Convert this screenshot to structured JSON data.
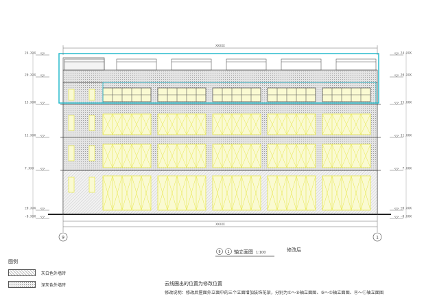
{
  "drawing": {
    "title_circle_a": "9",
    "title_circle_b": "1",
    "title": "轴立面图",
    "scale": "1:100",
    "status": "修改后",
    "total_width_dim": "XXXXX",
    "axis_left": "9",
    "axis_right": "1"
  },
  "levels_left": [
    {
      "label": "24.XXX"
    },
    {
      "label": "20.XXX"
    },
    {
      "label": "15.XXX"
    },
    {
      "label": "11.XXX"
    },
    {
      "label": "7.XXX"
    },
    {
      "label": "±0.XXX"
    },
    {
      "label": "-0.XXX"
    }
  ],
  "levels_right": [
    {
      "label": "24.XXX"
    },
    {
      "label": "20.XXX"
    },
    {
      "label": "15.XXX"
    },
    {
      "label": "11.XXX"
    },
    {
      "label": "7.XXX"
    },
    {
      "label": "±0.XXX"
    },
    {
      "label": "-0.XXX"
    }
  ],
  "legend": {
    "heading": "图例",
    "items": [
      {
        "label": "灰白色外墙砖",
        "pattern": "hatch"
      },
      {
        "label": "深灰色外墙砖",
        "pattern": "dots"
      }
    ]
  },
  "notes": {
    "line1": "云线圈出的位置为修改位置",
    "line2": "修改说明：修改后屋面外立面中的三个立面增加装饰花架，分别为①～⑨轴立面图、⑨～①轴立面图、Ⓐ～Ⓛ轴立面图"
  },
  "colors": {
    "cloud": "#19b7c9",
    "glass": "#e8e84a",
    "line": "#333333",
    "wall": "#d9d9d9"
  }
}
